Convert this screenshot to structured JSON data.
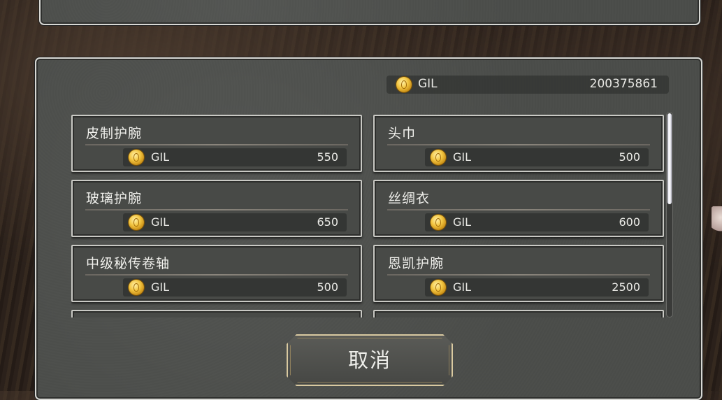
{
  "currency": {
    "label": "GIL",
    "balance": "200375861",
    "coin_icon": "gil-coin-icon"
  },
  "items": [
    {
      "name": "皮制护腕",
      "currency": "GIL",
      "price": "550"
    },
    {
      "name": "头巾",
      "currency": "GIL",
      "price": "500"
    },
    {
      "name": "玻璃护腕",
      "currency": "GIL",
      "price": "650"
    },
    {
      "name": "丝绸衣",
      "currency": "GIL",
      "price": "600"
    },
    {
      "name": "中级秘传卷轴",
      "currency": "GIL",
      "price": "500"
    },
    {
      "name": "恩凯护腕",
      "currency": "GIL",
      "price": "2500"
    },
    {
      "name": "",
      "currency": "",
      "price": ""
    },
    {
      "name": "",
      "currency": "",
      "price": ""
    }
  ],
  "scroll_position": 0,
  "buttons": {
    "cancel_label": "取消"
  },
  "colors": {
    "panel": "#4a4c49",
    "border": "#d8d8d4",
    "coin": "#f3c642",
    "scrollbar_thumb": "#ffffff"
  }
}
